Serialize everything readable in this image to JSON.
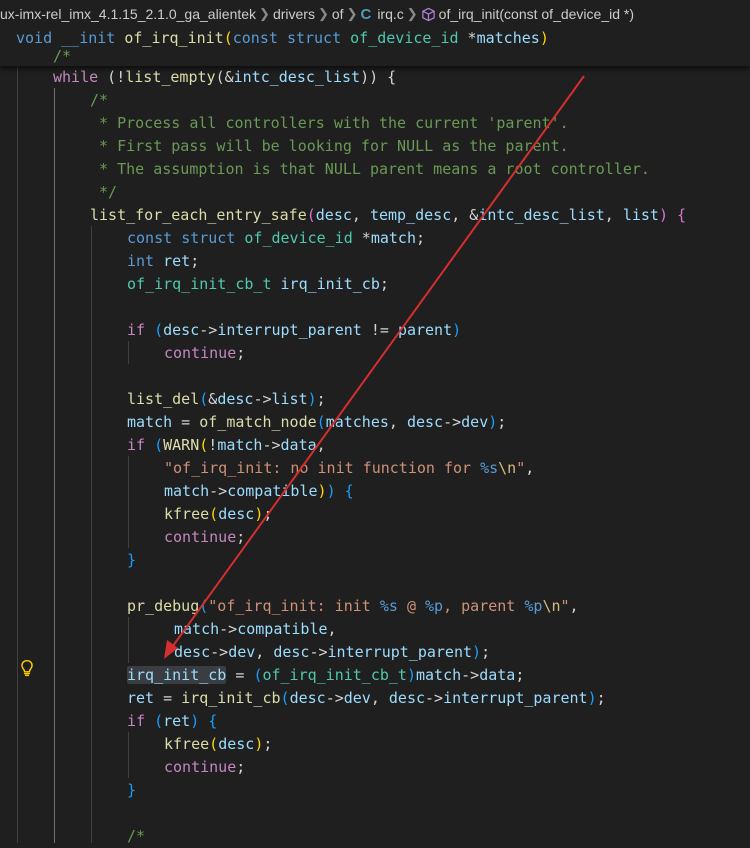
{
  "breadcrumb": {
    "repo": "ux-imx-rel_imx_4.1.15_2.1.0_ga_alientek",
    "dir1": "drivers",
    "dir2": "of",
    "file": "irq.c",
    "symbol": "of_irq_init(const of_device_id *)"
  },
  "editor": {
    "sticky": {
      "l1": {
        "kw": "void",
        "init": "__init",
        "fn": "of_irq_init",
        "p": "(",
        "kw2": "const",
        "kw3": "struct",
        "ty": "of_device_id",
        "rest": " *",
        "var": "matches",
        "pc": ")"
      },
      "l2": {
        "c": "/*"
      }
    },
    "code": {
      "l1": {
        "kw": "while",
        "a": " (!",
        "fn": "list_empty",
        "b": "(&",
        "var": "intc_desc_list",
        "c": ")) {"
      },
      "l2": {
        "c": "/*"
      },
      "l3": {
        "c": " * Process all controllers with the current 'parent'."
      },
      "l4": {
        "c": " * First pass will be looking for NULL as the parent."
      },
      "l5": {
        "c": " * The assumption is that NULL parent means a root controller."
      },
      "l6": {
        "c": " */"
      },
      "l7": {
        "fn": "list_for_each_entry_safe",
        "p": "(",
        "a1": "desc",
        "s1": ", ",
        "a2": "temp_desc",
        "s2": ", &",
        "a3": "intc_desc_list",
        "s3": ", ",
        "a4": "list",
        "pc": ")",
        "br": " {"
      },
      "l8": {
        "kw": "const",
        "kw2": "struct",
        "ty": "of_device_id",
        "rest": " *",
        "var": "match",
        "end": ";"
      },
      "l9": {
        "kw": "int",
        "var": "ret",
        "end": ";"
      },
      "l10": {
        "ty": "of_irq_init_cb_t",
        "var": "irq_init_cb",
        "end": ";"
      },
      "l11": {
        "kw": "if",
        "p": "(",
        "v1": "desc",
        "op1": "->",
        "v2": "interrupt_parent",
        "op2": " != ",
        "v3": "parent",
        "pc": ")"
      },
      "l12": {
        "kw": "continue",
        "end": ";"
      },
      "l13": {
        "fn": "list_del",
        "p": "(",
        "a": "&",
        "v1": "desc",
        "op1": "->",
        "v2": "list",
        "pc": ")",
        "end": ";"
      },
      "l14": {
        "v1": "match",
        "op": " = ",
        "fn": "of_match_node",
        "p": "(",
        "a1": "matches",
        "s1": ", ",
        "a2": "desc",
        "op1": "->",
        "a3": "dev",
        "pc": ")",
        "end": ";"
      },
      "l15": {
        "kw": "if",
        "p": "(",
        "fn": "WARN",
        "p2": "(",
        "a": "!",
        "v1": "match",
        "op1": "->",
        "v2": "data",
        "end": ","
      },
      "l16": {
        "s1": "\"of_irq_init: no init function for ",
        "fmt": "%s",
        "esc": "\\n",
        "s2": "\"",
        "end": ","
      },
      "l17": {
        "v1": "match",
        "op1": "->",
        "v2": "compatible",
        "pc2": ")",
        "pc": ")",
        "br": " {"
      },
      "l18": {
        "fn": "kfree",
        "p": "(",
        "v": "desc",
        "pc": ")",
        "end": ";"
      },
      "l19": {
        "kw": "continue",
        "end": ";"
      },
      "l20": {
        "br": "}"
      },
      "l21": {
        "fn": "pr_debug",
        "p": "(",
        "s1": "\"of_irq_init: init ",
        "f1": "%s",
        "s2": " @ ",
        "f2": "%p",
        "s3": ", parent ",
        "f3": "%p",
        "esc": "\\n",
        "s4": "\"",
        "end": ","
      },
      "l22": {
        "v1": "match",
        "op1": "->",
        "v2": "compatible",
        "end": ","
      },
      "l23": {
        "v1": "desc",
        "op1": "->",
        "v2": "dev",
        "s1": ", ",
        "v3": "desc",
        "op2": "->",
        "v4": "interrupt_parent",
        "pc": ")",
        "end": ";"
      },
      "l24": {
        "v1": "irq_init_cb",
        "op": " = ",
        "p": "(",
        "ty": "of_irq_init_cb_t",
        "pc": ")",
        "v2": "match",
        "op1": "->",
        "v3": "data",
        "end": ";"
      },
      "l25": {
        "v1": "ret",
        "op": " = ",
        "fn": "irq_init_cb",
        "p": "(",
        "v2": "desc",
        "op1": "->",
        "v3": "dev",
        "s1": ", ",
        "v4": "desc",
        "op2": "->",
        "v5": "interrupt_parent",
        "pc": ")",
        "end": ";"
      },
      "l26": {
        "kw": "if",
        "p": "(",
        "v": "ret",
        "pc": ")",
        "br": " {"
      },
      "l27": {
        "fn": "kfree",
        "p": "(",
        "v": "desc",
        "pc": ")",
        "end": ";"
      },
      "l28": {
        "kw": "continue",
        "end": ";"
      },
      "l29": {
        "br": "}"
      },
      "l30": {
        "c": "/*"
      }
    }
  },
  "colors": {
    "annotation_arrow": "#d32f2f",
    "lightbulb": "#ffcc00",
    "background": "#1f1f1f"
  },
  "icons": {
    "file_type": "c-language-icon",
    "symbol": "method-cube-icon",
    "gutter": "lightbulb-icon"
  }
}
